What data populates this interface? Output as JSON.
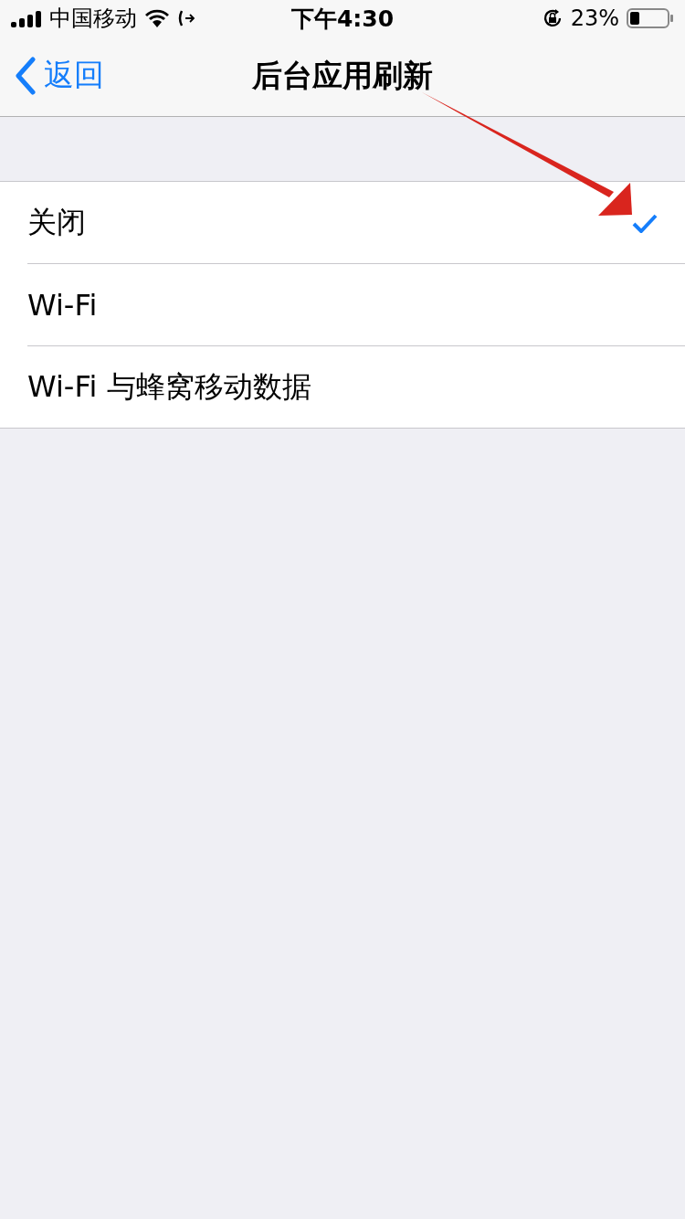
{
  "status_bar": {
    "carrier": "中国移动",
    "time": "下午4:30",
    "battery": "23%"
  },
  "nav": {
    "back": "返回",
    "title": "后台应用刷新"
  },
  "options": [
    {
      "label": "关闭",
      "selected": true
    },
    {
      "label": "Wi-Fi",
      "selected": false
    },
    {
      "label": "Wi-Fi 与蜂窝移动数据",
      "selected": false
    }
  ]
}
